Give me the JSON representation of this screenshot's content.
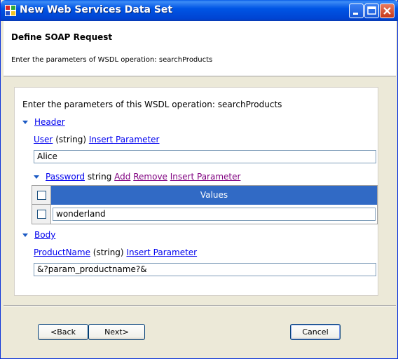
{
  "window": {
    "title": "New Web Services Data Set"
  },
  "header": {
    "title": "Define SOAP Request",
    "subtitle": "Enter the parameters of WSDL operation: searchProducts"
  },
  "content": {
    "intro": "Enter the parameters of this WSDL operation: searchProducts",
    "header_section": {
      "label": "Header",
      "user": {
        "name": "User",
        "type": "(string)",
        "insert_label": "Insert Parameter",
        "value": "Alice"
      },
      "password": {
        "name": "Password",
        "type": "string",
        "add_label": "Add",
        "remove_label": "Remove",
        "insert_label": "Insert Parameter",
        "grid_header": "Values",
        "rows": [
          "wonderland"
        ]
      }
    },
    "body_section": {
      "label": "Body",
      "product": {
        "name": "ProductName",
        "type": "(string)",
        "insert_label": "Insert Parameter",
        "value": "&?param_productname?&"
      }
    }
  },
  "footer": {
    "back_label": "<Back",
    "next_label": "Next>",
    "cancel_label": "Cancel"
  },
  "colors": {
    "titlebar": "#0055e5",
    "grid_header": "#316ac5",
    "link": "#0000ee",
    "visited_link": "#800080"
  },
  "icons": [
    "app-icon",
    "minimize-icon",
    "maximize-icon",
    "close-icon",
    "collapse-triangle-icon",
    "checkbox-icon"
  ]
}
